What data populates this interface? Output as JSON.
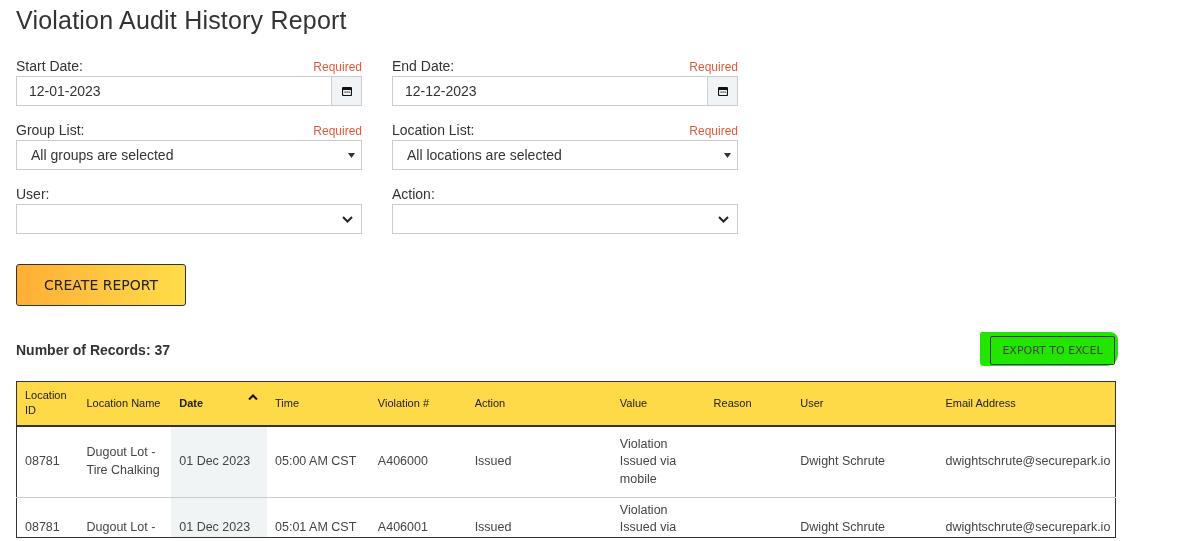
{
  "title": "Violation Audit History Report",
  "fields": [
    {
      "label": "Start Date:",
      "required": "Required",
      "kind": "date",
      "value": "12-01-2023"
    },
    {
      "label": "End Date:",
      "required": "Required",
      "kind": "date",
      "value": "12-12-2023"
    },
    {
      "label": "Group List:",
      "required": "Required",
      "kind": "multiselect",
      "value": "All groups are selected"
    },
    {
      "label": "Location List:",
      "required": "Required",
      "kind": "multiselect",
      "value": "All locations are selected"
    },
    {
      "label": "User:",
      "kind": "select"
    },
    {
      "label": "Action:",
      "kind": "select"
    }
  ],
  "create_button": "CREATE REPORT",
  "records_label": "Number of Records: 37",
  "export_button": {
    "label": "EXPORT TO EXCEL",
    "highlighted": true
  },
  "table": {
    "columns": [
      {
        "label": "Location ID",
        "sorted": false
      },
      {
        "label": "Location Name",
        "sorted": false
      },
      {
        "label": "Date",
        "sorted": true
      },
      {
        "label": "Time",
        "sorted": false
      },
      {
        "label": "Violation #",
        "sorted": false
      },
      {
        "label": "Action",
        "sorted": false
      },
      {
        "label": "Value",
        "sorted": false
      },
      {
        "label": "Reason",
        "sorted": false
      },
      {
        "label": "User",
        "sorted": false
      },
      {
        "label": "Email Address",
        "sorted": false
      }
    ],
    "rows": [
      [
        "08781",
        "Dugout Lot - Tire Chalking",
        "01 Dec 2023",
        "05:00 AM CST",
        "A406000",
        "Issued",
        "Violation Issued via mobile",
        "",
        "Dwight Schrute",
        "dwightschrute@securepark.io"
      ],
      [
        "08781",
        "Dugout Lot -",
        "01 Dec 2023",
        "05:01 AM CST",
        "A406001",
        "Issued",
        "Violation Issued via",
        "",
        "Dwight Schrute",
        "dwightschrute@securepark.io"
      ]
    ]
  }
}
